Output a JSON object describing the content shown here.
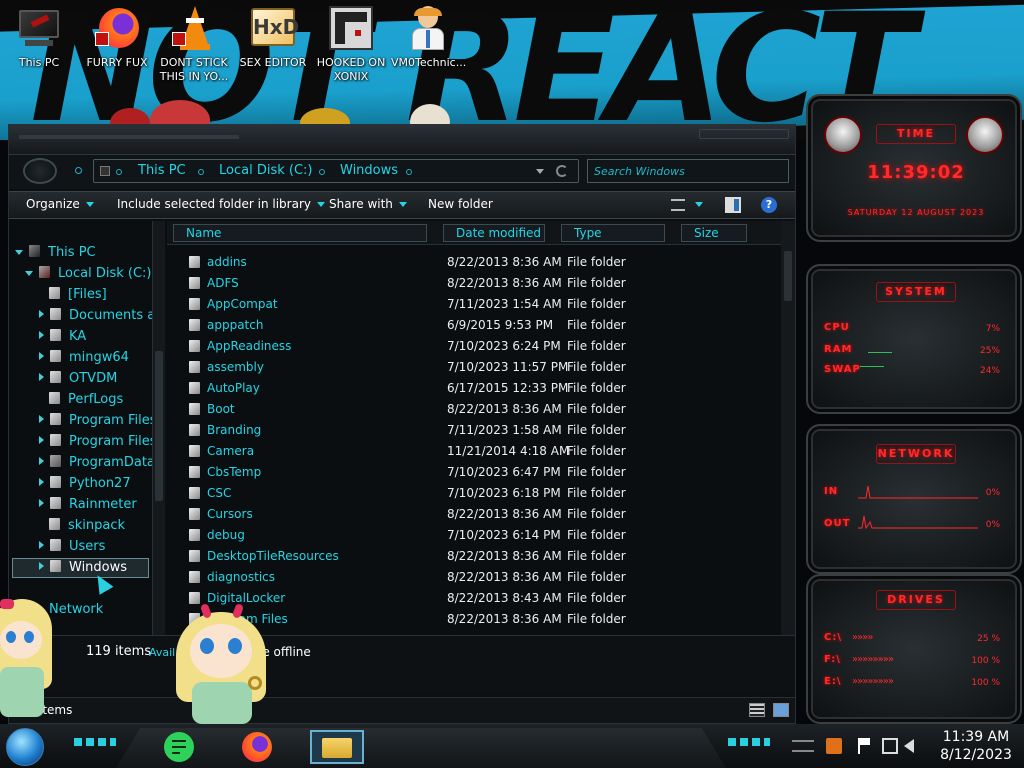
{
  "desktop": {
    "wallpaper_text": "NOT REACT",
    "icons": [
      {
        "label": "This PC",
        "icon": "computer-icon"
      },
      {
        "label": "FURRY FUX",
        "icon": "firefox-icon"
      },
      {
        "label": "DONT STICK THIS IN YO...",
        "icon": "vlc-cone-icon"
      },
      {
        "label": "SEX EDITOR",
        "icon": "hxd-editor-icon"
      },
      {
        "label": "HOOKED ON XONIX",
        "icon": "xonix-game-icon"
      },
      {
        "label": "VM0Technic...",
        "icon": "doctor-icon"
      }
    ]
  },
  "explorer": {
    "breadcrumb": [
      "This PC",
      "Local Disk (C:)",
      "Windows"
    ],
    "search_placeholder": "Search Windows",
    "toolbar": {
      "organize": "Organize",
      "include_library": "Include selected folder in library",
      "share_with": "Share with",
      "new_folder": "New folder"
    },
    "nav": [
      {
        "label": "This PC"
      },
      {
        "label": "Local Disk (C:)"
      },
      {
        "label": "[Files]"
      },
      {
        "label": "Documents ar"
      },
      {
        "label": "KA"
      },
      {
        "label": "mingw64"
      },
      {
        "label": "OTVDM"
      },
      {
        "label": "PerfLogs"
      },
      {
        "label": "Program Files"
      },
      {
        "label": "Program Files"
      },
      {
        "label": "ProgramData"
      },
      {
        "label": "Python27"
      },
      {
        "label": "Rainmeter"
      },
      {
        "label": "skinpack"
      },
      {
        "label": "Users"
      },
      {
        "label": "Windows"
      },
      {
        "label": "Network"
      }
    ],
    "columns": {
      "name": "Name",
      "date": "Date modified",
      "type": "Type",
      "size": "Size"
    },
    "files": [
      {
        "name": "addins",
        "date": "8/22/2013 8:36 AM",
        "type": "File folder"
      },
      {
        "name": "ADFS",
        "date": "8/22/2013 8:36 AM",
        "type": "File folder"
      },
      {
        "name": "AppCompat",
        "date": "7/11/2023 1:54 AM",
        "type": "File folder"
      },
      {
        "name": "apppatch",
        "date": "6/9/2015 9:53 PM",
        "type": "File folder"
      },
      {
        "name": "AppReadiness",
        "date": "7/10/2023 6:24 PM",
        "type": "File folder"
      },
      {
        "name": "assembly",
        "date": "7/10/2023 11:57 PM",
        "type": "File folder"
      },
      {
        "name": "AutoPlay",
        "date": "6/17/2015 12:33 PM",
        "type": "File folder"
      },
      {
        "name": "Boot",
        "date": "8/22/2013 8:36 AM",
        "type": "File folder"
      },
      {
        "name": "Branding",
        "date": "7/11/2023 1:58 AM",
        "type": "File folder"
      },
      {
        "name": "Camera",
        "date": "11/21/2014 4:18 AM",
        "type": "File folder"
      },
      {
        "name": "CbsTemp",
        "date": "7/10/2023 6:47 PM",
        "type": "File folder"
      },
      {
        "name": "CSC",
        "date": "7/10/2023 6:18 PM",
        "type": "File folder"
      },
      {
        "name": "Cursors",
        "date": "8/22/2013 8:36 AM",
        "type": "File folder"
      },
      {
        "name": "debug",
        "date": "7/10/2023 6:14 PM",
        "type": "File folder"
      },
      {
        "name": "DesktopTileResources",
        "date": "8/22/2013 8:36 AM",
        "type": "File folder"
      },
      {
        "name": "diagnostics",
        "date": "8/22/2013 8:36 AM",
        "type": "File folder"
      },
      {
        "name": "DigitalLocker",
        "date": "8/22/2013 8:43 AM",
        "type": "File folder"
      },
      {
        "name": "Program Files",
        "date": "8/22/2013 8:36 AM",
        "type": "File folder"
      }
    ],
    "details_text": "119 items",
    "details_avail": "Availab",
    "details_offline": "le offline",
    "status_items": "items"
  },
  "rainmeter": {
    "time_title": "TIME",
    "time": "11:39:02",
    "date": "SATURDAY 12 AUGUST 2023",
    "system_title": "SYSTEM",
    "cpu_label": "CPU",
    "cpu": "7%",
    "ram_label": "RAM",
    "ram": "25%",
    "swap_label": "SWAP",
    "swap": "24%",
    "network_title": "NETWORK",
    "in_label": "IN",
    "in": "0%",
    "out_label": "OUT",
    "out": "0%",
    "drives_title": "DRIVES",
    "drives": [
      {
        "label": "C:\\",
        "value": "25 %"
      },
      {
        "label": "F:\\",
        "value": "100 %"
      },
      {
        "label": "E:\\",
        "value": "100 %"
      }
    ]
  },
  "taskbar": {
    "time": "11:39 AM",
    "date": "8/12/2023"
  },
  "colors": {
    "accent": "#23d5e6",
    "rain_red": "#ff2a2a",
    "wall_blue": "#1fa3d2"
  }
}
